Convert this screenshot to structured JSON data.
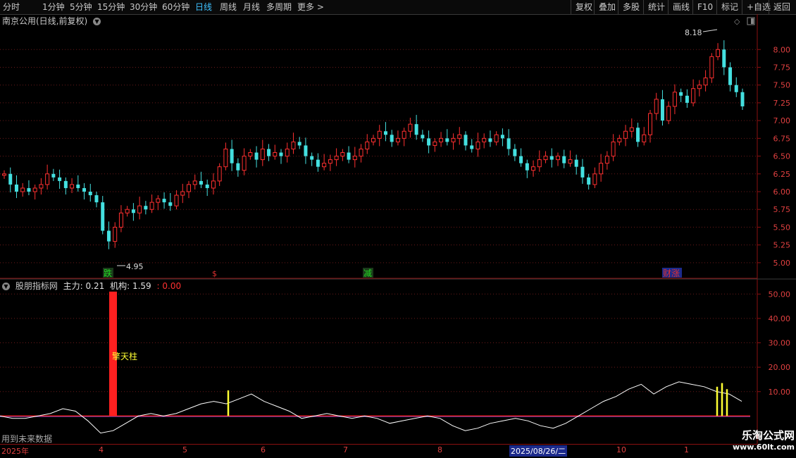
{
  "toolbar": {
    "periods": [
      "分时",
      "1分钟",
      "5分钟",
      "15分钟",
      "30分钟",
      "60分钟",
      "日线",
      "周线",
      "月线",
      "多周期",
      "更多 >"
    ],
    "active_period": "日线",
    "right_buttons": [
      "复权",
      "叠加",
      "多股",
      "统计",
      "画线",
      "F10",
      "标记",
      "+自选",
      "返回"
    ]
  },
  "stock": {
    "title": "南京公用(日线,前复权)"
  },
  "price_axis": [
    "8.00",
    "7.75",
    "7.50",
    "7.25",
    "7.00",
    "6.75",
    "6.50",
    "6.25",
    "6.00",
    "5.75",
    "5.50",
    "5.25",
    "5.00"
  ],
  "price_markers": {
    "high": "8.18",
    "low": "4.95"
  },
  "signals": [
    {
      "text": "跌",
      "color": "#22dd22"
    },
    {
      "text": "减",
      "color": "#22dd22"
    },
    {
      "text": "财涨",
      "color": "#e03030"
    }
  ],
  "indicator": {
    "name": "股朋指标网",
    "main_label": "主力:",
    "main_value": "0.21",
    "inst_label": "机构:",
    "inst_value": "1.59",
    "third_value": ": 0.00",
    "axis": [
      "50.00",
      "40.00",
      "30.00",
      "20.00",
      "10.00"
    ],
    "annotation": "擎天柱",
    "future_note": "用到未来数据"
  },
  "date_axis": {
    "year": "2025年",
    "months": [
      "4",
      "5",
      "6",
      "7",
      "8",
      "10",
      "1"
    ],
    "cursor_date": "2025/08/26/二"
  },
  "watermark": {
    "title": "乐淘公式网",
    "url": "www.60lt.com"
  },
  "colors": {
    "up": "#ff3030",
    "down": "#44e0e0",
    "axis": "#8b1010",
    "grid": "#6b1a1a",
    "highlight": "#ffff33"
  },
  "chart_data": [
    {
      "type": "candlestick",
      "title": "南京公用(日线,前复权)",
      "ylim": [
        4.85,
        8.3
      ],
      "y_ticks": [
        5.0,
        5.25,
        5.5,
        5.75,
        6.0,
        6.25,
        6.5,
        6.75,
        7.0,
        7.25,
        7.5,
        7.75,
        8.0
      ],
      "annotations": [
        {
          "label": "8.18",
          "kind": "high"
        },
        {
          "label": "4.95",
          "kind": "low"
        }
      ],
      "closes": [
        6.25,
        6.1,
        6.0,
        6.05,
        6.0,
        6.05,
        6.1,
        6.25,
        6.2,
        6.15,
        6.05,
        6.1,
        6.05,
        6.0,
        5.95,
        5.85,
        5.45,
        5.3,
        5.5,
        5.7,
        5.75,
        5.7,
        5.8,
        5.75,
        5.85,
        5.9,
        5.85,
        5.8,
        5.95,
        6.0,
        6.1,
        6.15,
        6.1,
        6.05,
        6.15,
        6.35,
        6.6,
        6.4,
        6.3,
        6.5,
        6.55,
        6.45,
        6.6,
        6.5,
        6.55,
        6.5,
        6.6,
        6.7,
        6.65,
        6.5,
        6.45,
        6.35,
        6.4,
        6.45,
        6.5,
        6.55,
        6.45,
        6.5,
        6.6,
        6.7,
        6.75,
        6.85,
        6.8,
        6.7,
        6.75,
        6.85,
        6.95,
        6.8,
        6.75,
        6.65,
        6.7,
        6.75,
        6.7,
        6.75,
        6.8,
        6.65,
        6.6,
        6.7,
        6.75,
        6.7,
        6.8,
        6.75,
        6.6,
        6.5,
        6.4,
        6.3,
        6.35,
        6.45,
        6.5,
        6.45,
        6.5,
        6.4,
        6.45,
        6.35,
        6.2,
        6.1,
        6.25,
        6.4,
        6.5,
        6.7,
        6.75,
        6.85,
        6.9,
        6.7,
        6.8,
        7.1,
        7.3,
        7.0,
        7.2,
        7.4,
        7.35,
        7.25,
        7.45,
        7.5,
        7.6,
        7.9,
        8.0,
        7.75,
        7.5,
        7.4,
        7.2
      ],
      "x_ticks": [
        "2025年",
        "4",
        "5",
        "6",
        "7",
        "8",
        "10",
        "1"
      ]
    },
    {
      "type": "line",
      "title": "股朋指标网",
      "ylim": [
        -10,
        55
      ],
      "y_ticks": [
        10,
        20,
        30,
        40,
        50
      ],
      "series": [
        {
          "name": "主力",
          "values": [
            0.21
          ]
        },
        {
          "name": "机构",
          "values": [
            1.59
          ]
        }
      ]
    }
  ]
}
